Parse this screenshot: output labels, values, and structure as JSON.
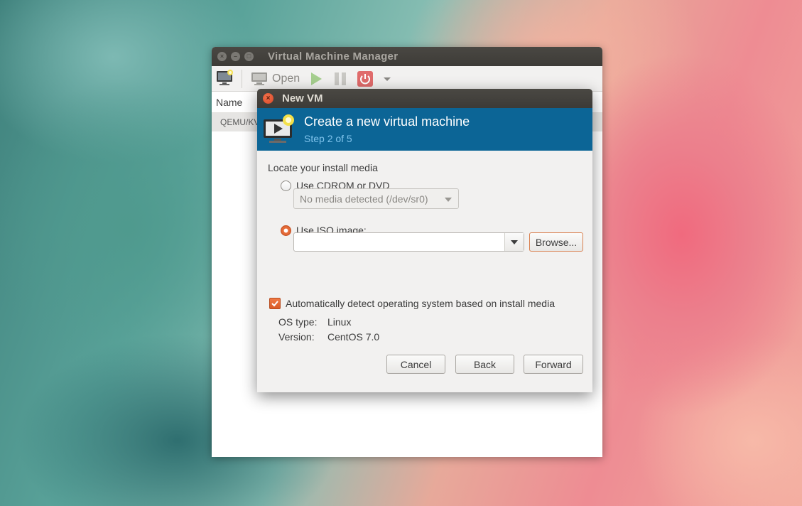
{
  "main_window": {
    "title": "Virtual Machine Manager",
    "toolbar": {
      "open_label": "Open"
    },
    "column_name": "Name",
    "connection_row": "QEMU/KVM"
  },
  "dialog": {
    "title": "New VM",
    "header_title": "Create a new virtual machine",
    "header_step": "Step 2 of 5",
    "locate_label": "Locate your install media",
    "cdrom_label": "Use CDROM or DVD",
    "cdrom_combo": "No media detected (/dev/sr0)",
    "iso_label": "Use ISO image:",
    "iso_value": "",
    "browse_label": "Browse...",
    "autodetect_label": "Automatically detect operating system based on install media",
    "os_type_label": "OS type:",
    "os_type_value": "Linux",
    "version_label": "Version:",
    "version_value": "CentOS 7.0",
    "cancel_label": "Cancel",
    "back_label": "Back",
    "forward_label": "Forward",
    "cdrom_selected": false,
    "iso_selected": true,
    "autodetect_checked": true
  },
  "colors": {
    "header_blue": "#0c6596",
    "accent_orange": "#e9703d",
    "titlebar": "#3d3b37"
  }
}
